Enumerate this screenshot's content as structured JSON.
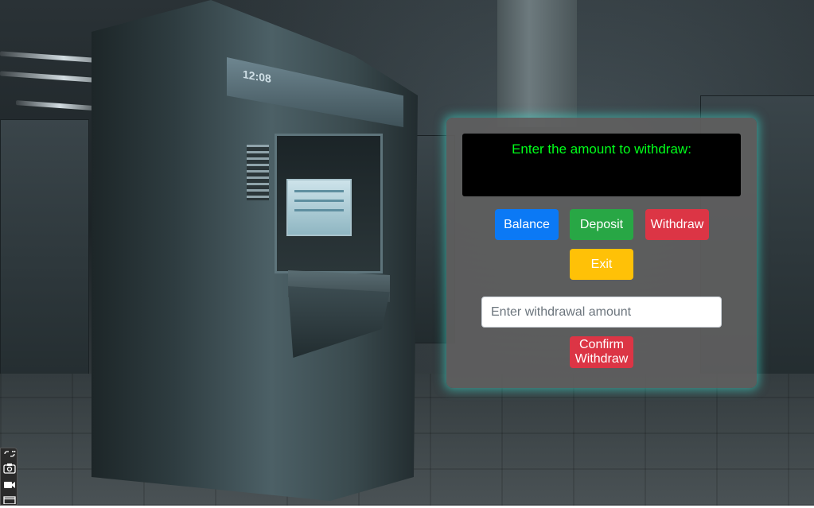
{
  "atm_ui": {
    "display_message": "Enter the amount to withdraw:",
    "buttons": {
      "balance": "Balance",
      "deposit": "Deposit",
      "withdraw": "Withdraw",
      "exit": "Exit",
      "confirm_withdraw": "Confirm Withdraw"
    },
    "amount_input": {
      "placeholder": "Enter withdrawal amount",
      "value": ""
    }
  },
  "background": {
    "atm_time_label": "12:08"
  },
  "toolbar": {
    "items": [
      "link-icon",
      "camera-icon",
      "video-icon",
      "window-icon"
    ]
  },
  "colors": {
    "display_text": "#00ff1a",
    "balance": "#0b79f5",
    "deposit": "#28a745",
    "withdraw": "#dc3545",
    "exit": "#ffc107",
    "panel_glow": "#40e0d0"
  }
}
